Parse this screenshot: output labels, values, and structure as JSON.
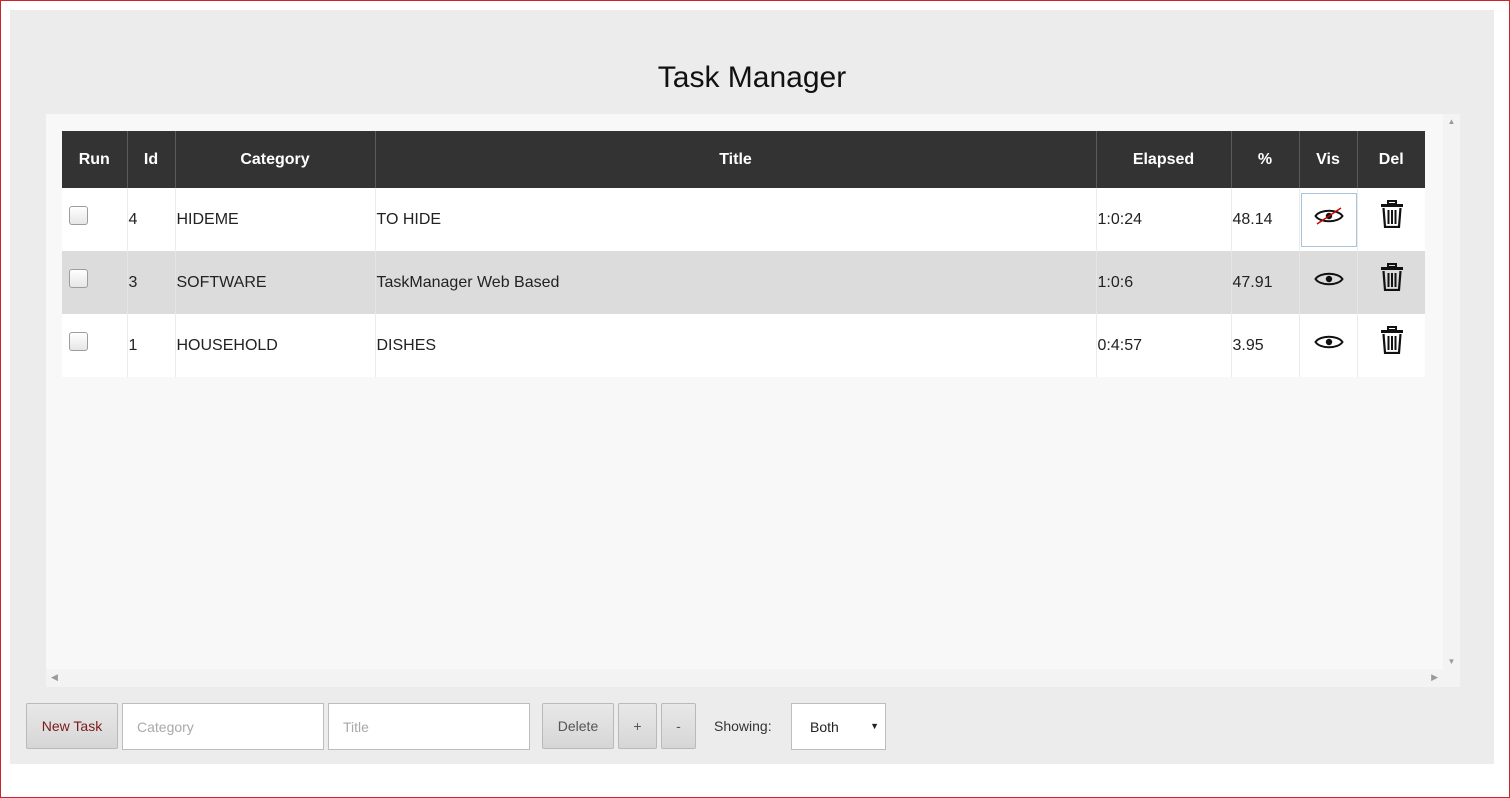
{
  "app": {
    "title": "Task Manager"
  },
  "table": {
    "columns": [
      "Run",
      "Id",
      "Category",
      "Title",
      "Elapsed",
      "%",
      "Vis",
      "Del"
    ],
    "rows": [
      {
        "run": false,
        "id": "4",
        "category": "HIDEME",
        "title": "TO HIDE",
        "elapsed": "1:0:24",
        "percent": "48.14",
        "visible": false,
        "vis_icon": "eye-slash-icon",
        "del_icon": "trash-icon"
      },
      {
        "run": false,
        "id": "3",
        "category": "SOFTWARE",
        "title": "TaskManager Web Based",
        "elapsed": "1:0:6",
        "percent": "47.91",
        "visible": true,
        "vis_icon": "eye-icon",
        "del_icon": "trash-icon"
      },
      {
        "run": false,
        "id": "1",
        "category": "HOUSEHOLD",
        "title": "DISHES",
        "elapsed": "0:4:57",
        "percent": "3.95",
        "visible": true,
        "vis_icon": "eye-icon",
        "del_icon": "trash-icon"
      }
    ]
  },
  "toolbar": {
    "new_task_label": "New Task",
    "category_placeholder": "Category",
    "title_placeholder": "Title",
    "delete_label": "Delete",
    "plus_label": "+",
    "minus_label": "-",
    "showing_label": "Showing:",
    "showing_value": "Both"
  },
  "colors": {
    "header_bg": "#333333",
    "row_alt_bg": "#dcdcdc",
    "app_bg": "#ececec",
    "window_border": "#c9262f",
    "new_task_text": "#7a1b1b",
    "hidden_slash": "#cc0000"
  }
}
